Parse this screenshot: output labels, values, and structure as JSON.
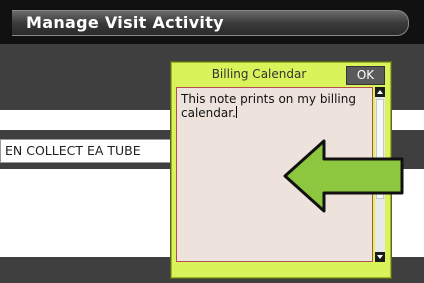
{
  "header": {
    "title": "Manage Visit Activity"
  },
  "main": {
    "field_value": "EN COLLECT EA TUBE"
  },
  "popup": {
    "title": "Billing Calendar",
    "ok_label": "OK",
    "note_text": "This note prints on my billing calendar."
  },
  "annotation": {
    "arrow_color": "#8dc63f"
  },
  "icons": {
    "arrow": "left-arrow-icon",
    "scroll_up": "scroll-up-icon",
    "scroll_down": "scroll-down-icon"
  }
}
